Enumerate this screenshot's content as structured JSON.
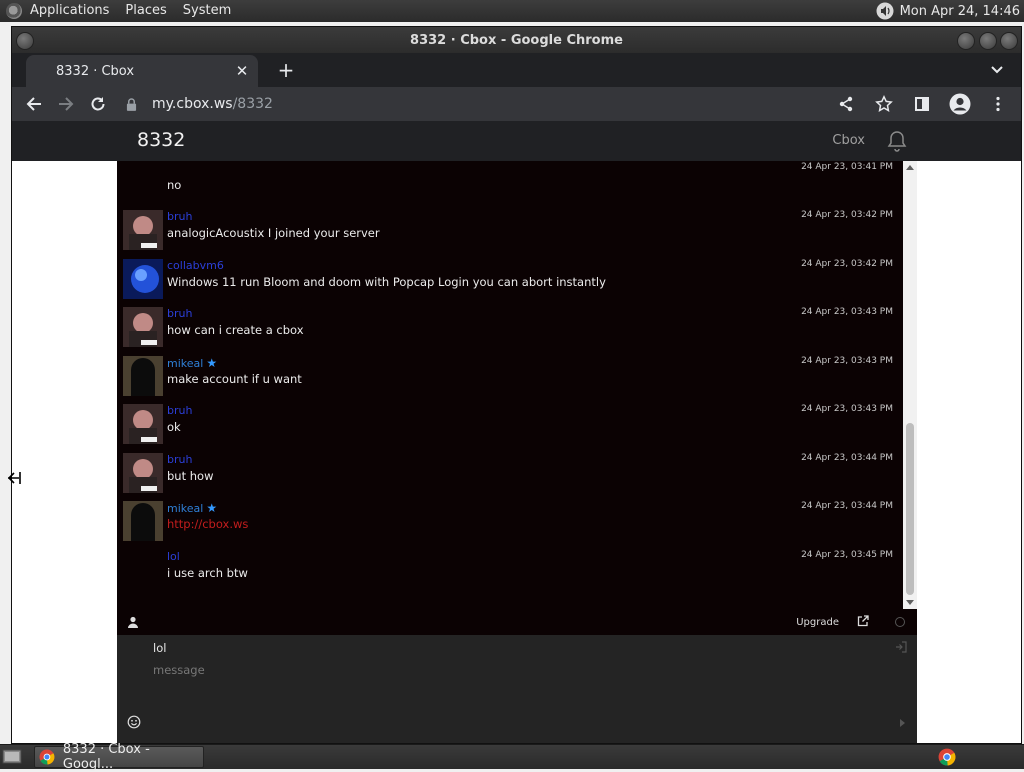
{
  "top_panel": {
    "menus": [
      "Applications",
      "Places",
      "System"
    ],
    "clock": "Mon Apr 24, 14:46"
  },
  "window": {
    "title": "8332 · Cbox - Google Chrome"
  },
  "browser": {
    "tab_title": "8332 · Cbox",
    "new_tab_label": "+",
    "url_host": "my.cbox.ws",
    "url_path": "/8332"
  },
  "site": {
    "title": "8332",
    "brand_link": "Cbox"
  },
  "messages": [
    {
      "user": "",
      "time": "24 Apr 23, 03:41 PM",
      "text": "no",
      "avatar": "none"
    },
    {
      "user": "bruh",
      "time": "24 Apr 23, 03:42 PM",
      "text": "analogicAcoustix I joined your server",
      "avatar": "bruh"
    },
    {
      "user": "collabvm6",
      "time": "24 Apr 23, 03:42 PM",
      "text": "Windows 11 run Bloom and doom with Popcap Login you can abort instantly",
      "avatar": "blue"
    },
    {
      "user": "bruh",
      "time": "24 Apr 23, 03:43 PM",
      "text": "how can i create a cbox",
      "avatar": "bruh"
    },
    {
      "user": "mikeal",
      "time": "24 Apr 23, 03:43 PM",
      "text": "make account if u want",
      "avatar": "dark",
      "mod": true
    },
    {
      "user": "bruh",
      "time": "24 Apr 23, 03:43 PM",
      "text": "ok",
      "avatar": "bruh"
    },
    {
      "user": "bruh",
      "time": "24 Apr 23, 03:44 PM",
      "text": "but how",
      "avatar": "bruh"
    },
    {
      "user": "mikeal",
      "time": "24 Apr 23, 03:44 PM",
      "text": "http://cbox.ws",
      "avatar": "dark",
      "mod": true,
      "link": true
    },
    {
      "user": "lol",
      "time": "24 Apr 23, 03:45 PM",
      "text": "i use arch btw",
      "avatar": "none"
    }
  ],
  "chat_footer": {
    "upgrade_label": "Upgrade"
  },
  "compose": {
    "name_value": "lol",
    "message_placeholder": "message"
  },
  "taskbar": {
    "task_label": "8332 · Cbox - Googl..."
  },
  "colors": {
    "chat_bg": "#0b0203",
    "username": "#2b3fd8",
    "link": "#c21d1d",
    "mod_star": "#3399ff"
  }
}
